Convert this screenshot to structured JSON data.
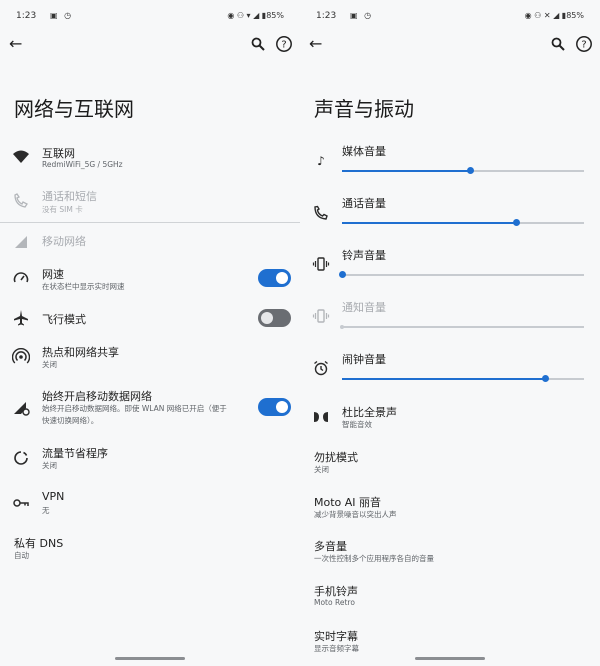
{
  "left": {
    "status": {
      "time": "1:23",
      "battery": "85%"
    },
    "title": "网络与互联网",
    "items": [
      {
        "title": "互联网",
        "sub": "RedmiWiFi_5G / 5GHz"
      },
      {
        "title": "通话和短信",
        "sub": "没有 SIM 卡"
      },
      {
        "title": "移动网络"
      },
      {
        "title": "网速",
        "sub": "在状态栏中显示实时网速",
        "toggle": "on"
      },
      {
        "title": "飞行模式",
        "toggle": "off"
      },
      {
        "title": "热点和网络共享",
        "sub": "关闭"
      },
      {
        "title": "始终开启移动数据网络",
        "sub1": "始终开启移动数据网络。即使 WLAN 网络已开启（便于",
        "sub2": "快速切换网络）。",
        "toggle": "on"
      },
      {
        "title": "流量节省程序",
        "sub": "关闭"
      },
      {
        "title": "VPN",
        "sub": "无"
      },
      {
        "title": "私有 DNS",
        "sub": "自动"
      }
    ]
  },
  "right": {
    "status": {
      "time": "1:23",
      "battery": "85%"
    },
    "title": "声音与振动",
    "volumes": [
      {
        "title": "媒体音量",
        "level": 0.53
      },
      {
        "title": "通话音量",
        "level": 0.72
      },
      {
        "title": "铃声音量",
        "level": 0.0
      },
      {
        "title": "通知音量",
        "level": 0.0,
        "disabled": true
      },
      {
        "title": "闹钟音量",
        "level": 0.84
      }
    ],
    "items": [
      {
        "title": "杜比全景声",
        "sub": "智能音效"
      },
      {
        "title": "勿扰模式",
        "sub": "关闭"
      },
      {
        "title": "Moto AI 丽音",
        "sub": "减少背景噪音以突出人声"
      },
      {
        "title": "多音量",
        "sub": "一次性控制多个应用程序各自的音量"
      },
      {
        "title": "手机铃声",
        "sub": "Moto Retro"
      },
      {
        "title": "实时字幕",
        "sub": "显示音频字幕"
      }
    ]
  }
}
